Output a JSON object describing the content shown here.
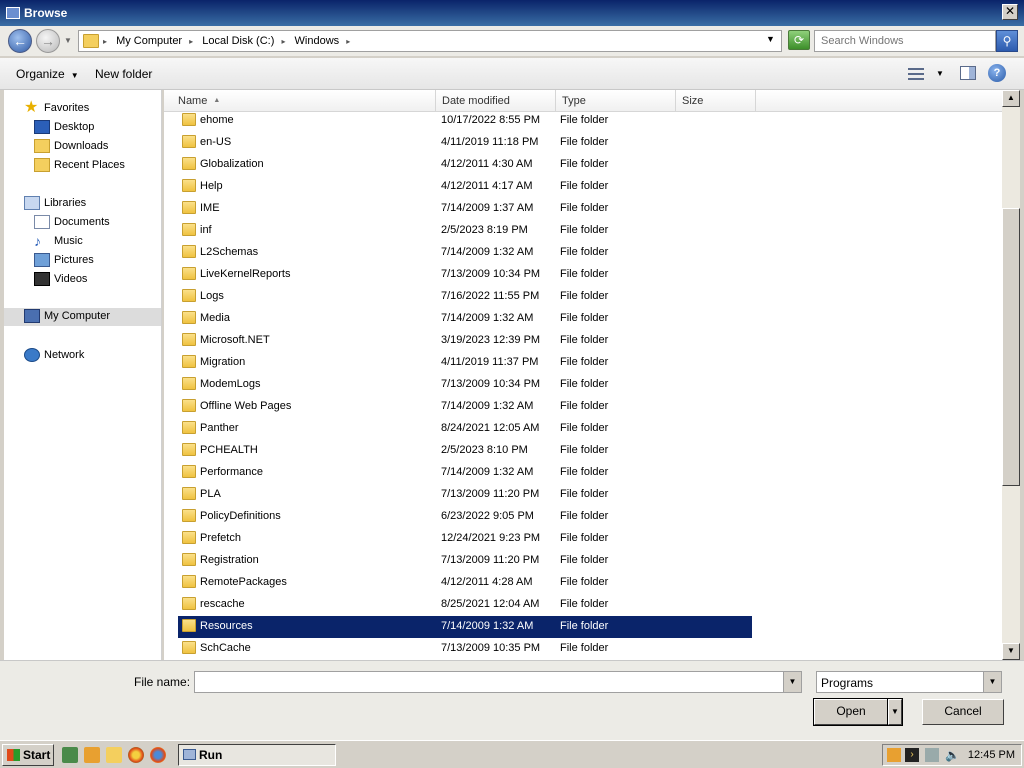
{
  "window": {
    "title": "Browse"
  },
  "address": {
    "crumbs": [
      "My Computer",
      "Local Disk (C:)",
      "Windows"
    ],
    "search_placeholder": "Search Windows"
  },
  "toolbar": {
    "organize": "Organize",
    "new_folder": "New folder"
  },
  "nav": {
    "favorites": "Favorites",
    "desktop": "Desktop",
    "downloads": "Downloads",
    "recent": "Recent Places",
    "libraries": "Libraries",
    "documents": "Documents",
    "music": "Music",
    "pictures": "Pictures",
    "videos": "Videos",
    "computer": "My Computer",
    "network": "Network"
  },
  "columns": {
    "name": "Name",
    "date": "Date modified",
    "type": "Type",
    "size": "Size"
  },
  "files": [
    {
      "name": "ehome",
      "date": "10/17/2022 8:55 PM",
      "type": "File folder"
    },
    {
      "name": "en-US",
      "date": "4/11/2019 11:18 PM",
      "type": "File folder"
    },
    {
      "name": "Globalization",
      "date": "4/12/2011 4:30 AM",
      "type": "File folder"
    },
    {
      "name": "Help",
      "date": "4/12/2011 4:17 AM",
      "type": "File folder"
    },
    {
      "name": "IME",
      "date": "7/14/2009 1:37 AM",
      "type": "File folder"
    },
    {
      "name": "inf",
      "date": "2/5/2023 8:19 PM",
      "type": "File folder"
    },
    {
      "name": "L2Schemas",
      "date": "7/14/2009 1:32 AM",
      "type": "File folder"
    },
    {
      "name": "LiveKernelReports",
      "date": "7/13/2009 10:34 PM",
      "type": "File folder"
    },
    {
      "name": "Logs",
      "date": "7/16/2022 11:55 PM",
      "type": "File folder"
    },
    {
      "name": "Media",
      "date": "7/14/2009 1:32 AM",
      "type": "File folder"
    },
    {
      "name": "Microsoft.NET",
      "date": "3/19/2023 12:39 PM",
      "type": "File folder"
    },
    {
      "name": "Migration",
      "date": "4/11/2019 11:37 PM",
      "type": "File folder"
    },
    {
      "name": "ModemLogs",
      "date": "7/13/2009 10:34 PM",
      "type": "File folder"
    },
    {
      "name": "Offline Web Pages",
      "date": "7/14/2009 1:32 AM",
      "type": "File folder"
    },
    {
      "name": "Panther",
      "date": "8/24/2021 12:05 AM",
      "type": "File folder"
    },
    {
      "name": "PCHEALTH",
      "date": "2/5/2023 8:10 PM",
      "type": "File folder"
    },
    {
      "name": "Performance",
      "date": "7/14/2009 1:32 AM",
      "type": "File folder"
    },
    {
      "name": "PLA",
      "date": "7/13/2009 11:20 PM",
      "type": "File folder"
    },
    {
      "name": "PolicyDefinitions",
      "date": "6/23/2022 9:05 PM",
      "type": "File folder"
    },
    {
      "name": "Prefetch",
      "date": "12/24/2021 9:23 PM",
      "type": "File folder"
    },
    {
      "name": "Registration",
      "date": "7/13/2009 11:20 PM",
      "type": "File folder"
    },
    {
      "name": "RemotePackages",
      "date": "4/12/2011 4:28 AM",
      "type": "File folder"
    },
    {
      "name": "rescache",
      "date": "8/25/2021 12:04 AM",
      "type": "File folder"
    },
    {
      "name": "Resources",
      "date": "7/14/2009 1:32 AM",
      "type": "File folder",
      "selected": true
    },
    {
      "name": "SchCache",
      "date": "7/13/2009 10:35 PM",
      "type": "File folder"
    }
  ],
  "bottom": {
    "file_name_label": "File name:",
    "file_name_value": "",
    "filter_value": "Programs",
    "open": "Open",
    "cancel": "Cancel"
  },
  "taskbar": {
    "start": "Start",
    "task_run": "Run",
    "clock": "12:45 PM"
  }
}
